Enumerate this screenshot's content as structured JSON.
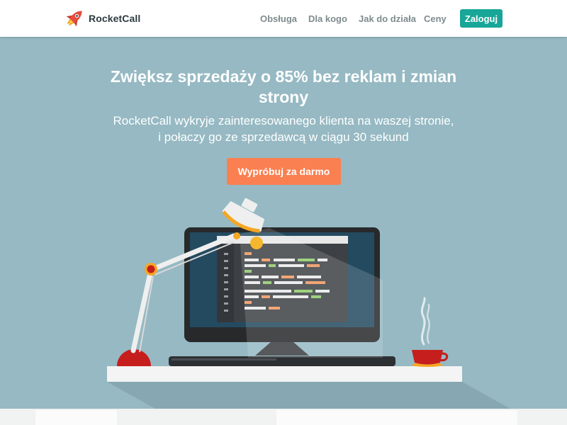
{
  "brand": {
    "name": "RocketCall",
    "logo_icon": "rocket-icon"
  },
  "nav": {
    "items": [
      {
        "label": "Obsługa"
      },
      {
        "label": "Dla kogo"
      },
      {
        "label": "Jak do działa"
      },
      {
        "label": "Ceny"
      }
    ],
    "login_label": "Zaloguj"
  },
  "hero": {
    "headline_line1": "Zwiększ sprzedaży o 85% bez reklam i zmian",
    "headline_line2": "strony",
    "sub_line1": "RocketCall wykryje zainteresowanego klienta na waszej stronie,",
    "sub_line2": "i połaczy go ze sprzedawcą w ciągu 30 sekund",
    "cta_label": "Wypróbuj za darmo"
  },
  "colors": {
    "hero_bg": "#96b9c3",
    "accent_teal": "#17a697",
    "cta_orange": "#fa8052",
    "lamp_red": "#c61d1d",
    "monitor_frame": "#27292b",
    "screen_bg": "#244a60"
  }
}
